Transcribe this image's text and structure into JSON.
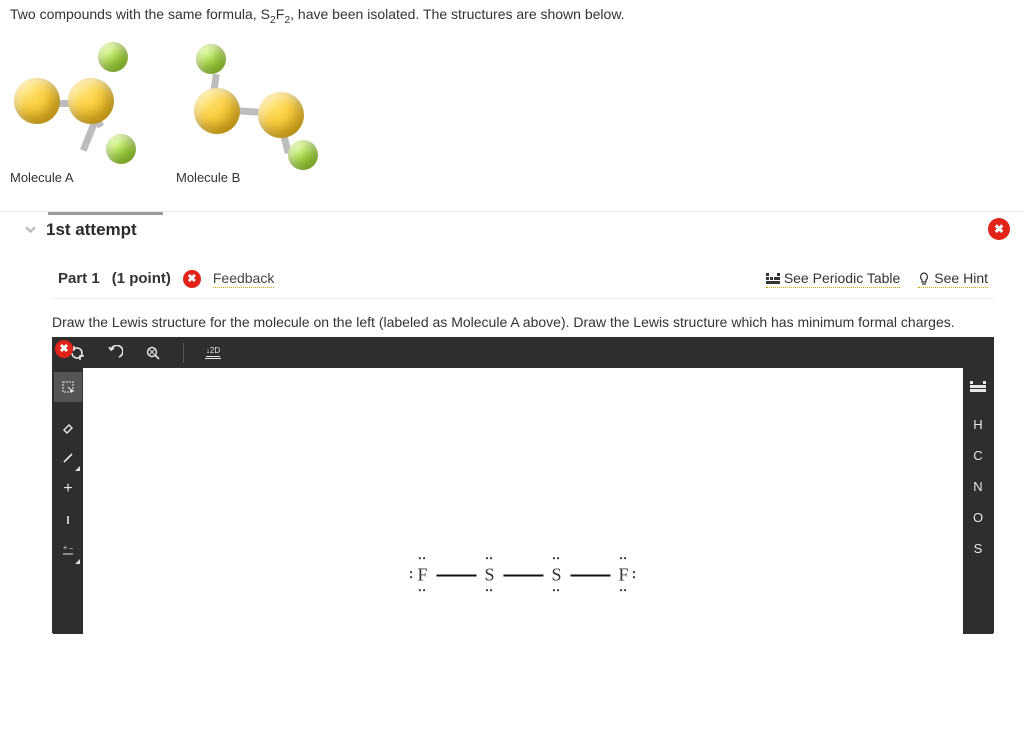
{
  "question": {
    "prefix": "Two compounds with the same formula, ",
    "formula_base": "S",
    "formula_sub1": "2",
    "formula_mid": "F",
    "formula_sub2": "2",
    "suffix": ", have been isolated. The structures are shown below."
  },
  "molecules": {
    "a_label": "Molecule A",
    "b_label": "Molecule B"
  },
  "attempt": {
    "title": "1st attempt"
  },
  "part": {
    "label": "Part 1",
    "points": "(1 point)",
    "feedback": "Feedback",
    "periodic": "See Periodic Table",
    "hint": "See Hint",
    "instruction": "Draw the Lewis structure for the molecule on the left (labeled as Molecule A above). Draw the Lewis structure which has minimum formal charges."
  },
  "toolbar": {
    "mode2d": "2D"
  },
  "right_elements": [
    "H",
    "C",
    "N",
    "O",
    "S"
  ],
  "lewis": {
    "atoms": [
      "F",
      "S",
      "S",
      "F"
    ]
  }
}
